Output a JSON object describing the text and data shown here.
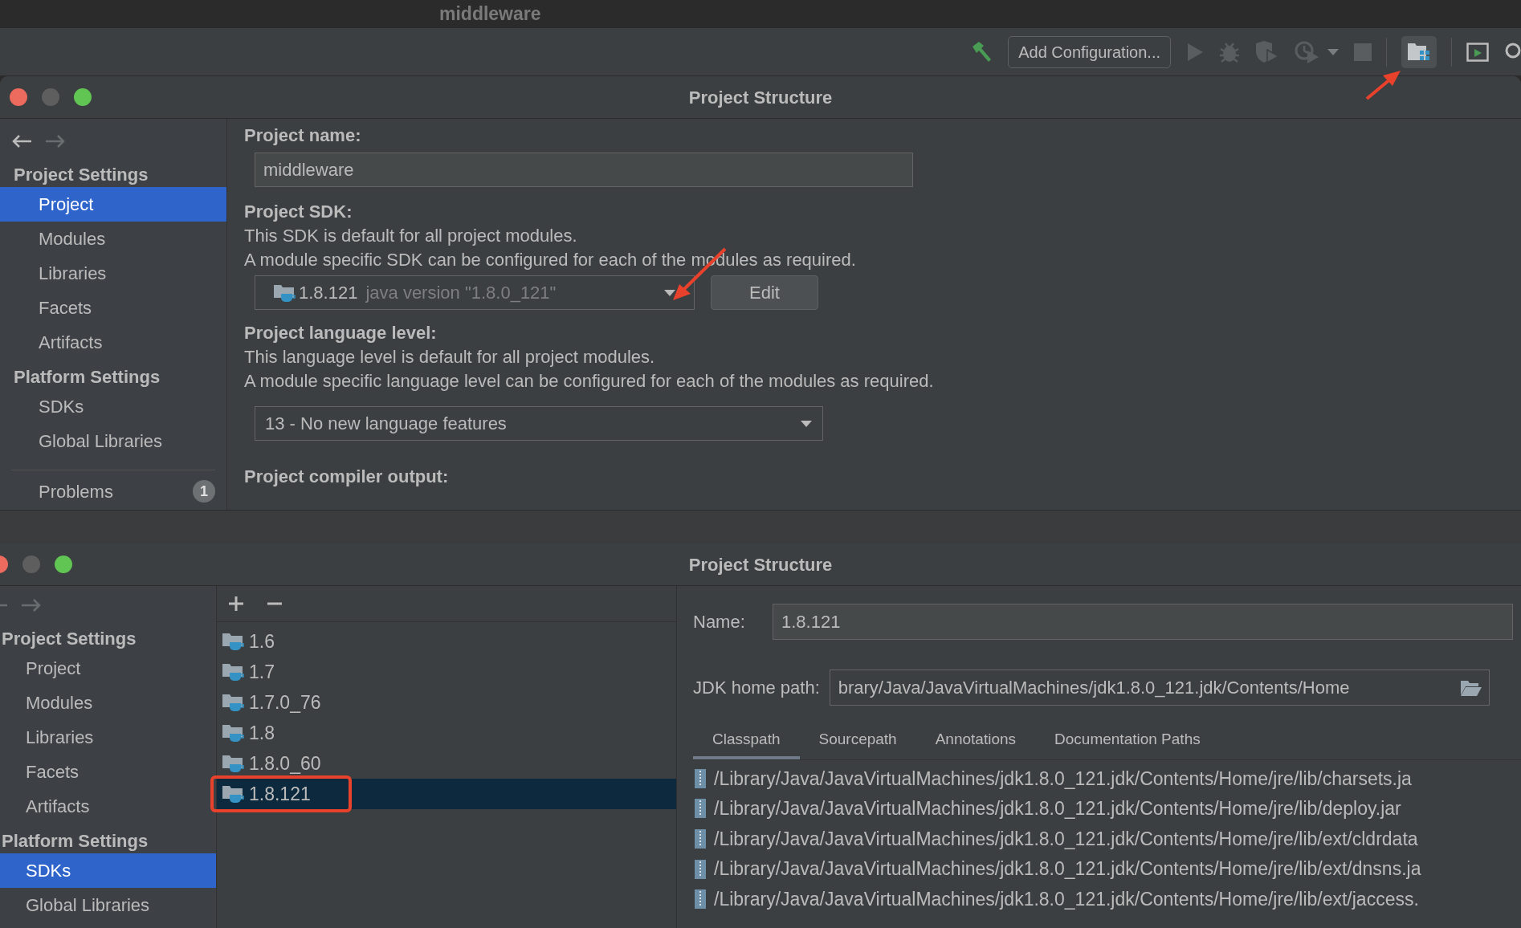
{
  "ide": {
    "title": "middleware",
    "run_config": "Add Configuration..."
  },
  "top_window": {
    "title": "Project Structure",
    "sidebar": {
      "sections": [
        {
          "heading": "Project Settings",
          "items": [
            {
              "label": "Project",
              "selected": true
            },
            {
              "label": "Modules",
              "selected": false
            },
            {
              "label": "Libraries",
              "selected": false
            },
            {
              "label": "Facets",
              "selected": false
            },
            {
              "label": "Artifacts",
              "selected": false
            }
          ]
        },
        {
          "heading": "Platform Settings",
          "items": [
            {
              "label": "SDKs",
              "selected": false
            },
            {
              "label": "Global Libraries",
              "selected": false
            }
          ]
        }
      ],
      "problems": {
        "label": "Problems",
        "count": "1"
      }
    },
    "project_name": {
      "label": "Project name:",
      "value": "middleware"
    },
    "sdk": {
      "label": "Project SDK:",
      "lines": [
        "This SDK is default for all project modules.",
        "A module specific SDK can be configured for each of the modules as required."
      ],
      "value": "1.8.121",
      "detail": "java version \"1.8.0_121\"",
      "edit": "Edit"
    },
    "language_level": {
      "label": "Project language level:",
      "lines": [
        "This language level is default for all project modules.",
        "A module specific language level can be configured for each of the modules as required."
      ],
      "value": "13 - No new language features"
    },
    "compiler_output": {
      "label": "Project compiler output:"
    }
  },
  "bottom_window": {
    "title": "Project Structure",
    "sidebar": {
      "sections": [
        {
          "heading": "Project Settings",
          "items": [
            {
              "label": "Project",
              "selected": false
            },
            {
              "label": "Modules",
              "selected": false
            },
            {
              "label": "Libraries",
              "selected": false
            },
            {
              "label": "Facets",
              "selected": false
            },
            {
              "label": "Artifacts",
              "selected": false
            }
          ]
        },
        {
          "heading": "Platform Settings",
          "items": [
            {
              "label": "SDKs",
              "selected": true
            },
            {
              "label": "Global Libraries",
              "selected": false
            }
          ]
        }
      ]
    },
    "sdk_list": [
      {
        "label": "1.6",
        "selected": false
      },
      {
        "label": "1.7",
        "selected": false
      },
      {
        "label": "1.7.0_76",
        "selected": false
      },
      {
        "label": "1.8",
        "selected": false
      },
      {
        "label": "1.8.0_60",
        "selected": false
      },
      {
        "label": "1.8.121",
        "selected": true
      }
    ],
    "name": {
      "label": "Name:",
      "value": "1.8.121"
    },
    "jdk_home": {
      "label": "JDK home path:",
      "value": "brary/Java/JavaVirtualMachines/jdk1.8.0_121.jdk/Contents/Home"
    },
    "tabs": [
      {
        "label": "Classpath",
        "selected": true
      },
      {
        "label": "Sourcepath",
        "selected": false
      },
      {
        "label": "Annotations",
        "selected": false
      },
      {
        "label": "Documentation Paths",
        "selected": false
      }
    ],
    "classpath": [
      "/Library/Java/JavaVirtualMachines/jdk1.8.0_121.jdk/Contents/Home/jre/lib/charsets.ja",
      "/Library/Java/JavaVirtualMachines/jdk1.8.0_121.jdk/Contents/Home/jre/lib/deploy.jar",
      "/Library/Java/JavaVirtualMachines/jdk1.8.0_121.jdk/Contents/Home/jre/lib/ext/cldrdata",
      "/Library/Java/JavaVirtualMachines/jdk1.8.0_121.jdk/Contents/Home/jre/lib/ext/dnsns.ja",
      "/Library/Java/JavaVirtualMachines/jdk1.8.0_121.jdk/Contents/Home/jre/lib/ext/jaccess."
    ]
  }
}
